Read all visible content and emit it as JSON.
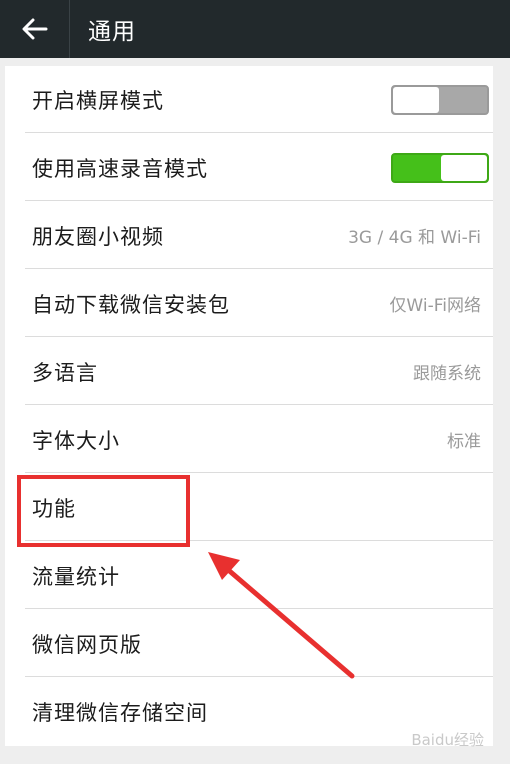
{
  "header": {
    "title": "通用"
  },
  "settings": [
    {
      "label": "开启横屏模式",
      "control": "toggle",
      "state": "off"
    },
    {
      "label": "使用高速录音模式",
      "control": "toggle",
      "state": "on"
    },
    {
      "label": "朋友圈小视频",
      "value": "3G / 4G 和 Wi-Fi"
    },
    {
      "label": "自动下载微信安装包",
      "value": "仅Wi-Fi网络"
    },
    {
      "label": "多语言",
      "value": "跟随系统"
    },
    {
      "label": "字体大小",
      "value": "标准"
    },
    {
      "label": "功能",
      "value": ""
    },
    {
      "label": "流量统计",
      "value": ""
    },
    {
      "label": "微信网页版",
      "value": ""
    },
    {
      "label": "清理微信存储空间",
      "value": ""
    }
  ],
  "colors": {
    "header_bg": "#22292c",
    "toggle_on": "#45c01a",
    "toggle_off": "#a8a8a8",
    "annotation": "#e8302f"
  },
  "watermark": "Baidu经验"
}
